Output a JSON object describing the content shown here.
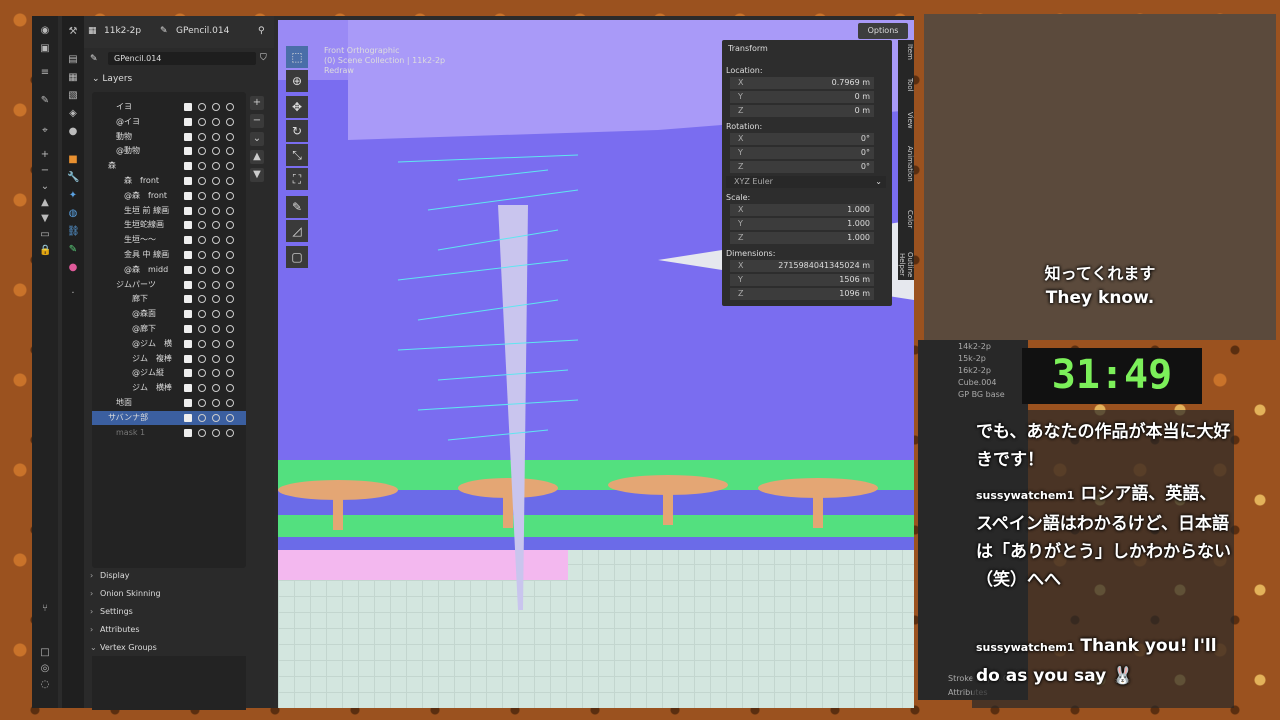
{
  "properties": {
    "header_scene": "11k2-2p",
    "header_object": "GPencil.014",
    "data_name": "GPencil.014"
  },
  "layers_title": "Layers",
  "layers": [
    {
      "name": "イヨ",
      "indent": 1
    },
    {
      "name": "@イヨ",
      "indent": 1
    },
    {
      "name": "動物",
      "indent": 1
    },
    {
      "name": "@動物",
      "indent": 1
    },
    {
      "name": "森",
      "indent": 0,
      "group": true
    },
    {
      "name": "森　front",
      "indent": 2
    },
    {
      "name": "@森　front",
      "indent": 2
    },
    {
      "name": "生垣 前 線画",
      "indent": 2
    },
    {
      "name": "生垣蛇線画",
      "indent": 2
    },
    {
      "name": "生垣〜〜",
      "indent": 2
    },
    {
      "name": "金具 中 線画",
      "indent": 2
    },
    {
      "name": "@森　midd",
      "indent": 2
    },
    {
      "name": "ジムパーツ",
      "indent": 1,
      "group": true
    },
    {
      "name": "廊下",
      "indent": 3
    },
    {
      "name": "@森面",
      "indent": 3
    },
    {
      "name": "@廊下",
      "indent": 3
    },
    {
      "name": "@ジム　横",
      "indent": 3
    },
    {
      "name": "ジム　複棒",
      "indent": 3
    },
    {
      "name": "@ジム縦",
      "indent": 3
    },
    {
      "name": "ジム　横棒",
      "indent": 3
    },
    {
      "name": "地面",
      "indent": 1
    },
    {
      "name": "サバンナ部",
      "indent": 0,
      "group": true,
      "selected": true
    },
    {
      "name": "mask 1",
      "indent": 1,
      "dim": true
    }
  ],
  "sections": [
    "Display",
    "Onion Skinning",
    "Settings",
    "Attributes",
    "Vertex Groups"
  ],
  "viewport": {
    "overlay_line1": "Front Orthographic",
    "overlay_line2": "(0) Scene Collection | 11k2-2p",
    "overlay_line3": "Redraw",
    "options_label": "Options"
  },
  "transform": {
    "title": "Transform",
    "location_label": "Location:",
    "location": {
      "x": "0.7969 m",
      "y": "0 m",
      "z": "0 m"
    },
    "rotation_label": "Rotation:",
    "rotation": {
      "x": "0°",
      "y": "0°",
      "z": "0°"
    },
    "rotation_mode": "XYZ Euler",
    "scale_label": "Scale:",
    "scale": {
      "x": "1.000",
      "y": "1.000",
      "z": "1.000"
    },
    "dimensions_label": "Dimensions:",
    "dimensions": {
      "x": "2715984041345024 m",
      "y": "1506 m",
      "z": "1096 m"
    }
  },
  "ntabs": [
    "Item",
    "Tool",
    "View",
    "Animation",
    "Color",
    "Outline Helper"
  ],
  "outliner_items": [
    "14k2-2p",
    "15k-2p",
    "16k2-2p",
    "Cube.004",
    "GP BG base"
  ],
  "stream": {
    "subtitle_jp": "知ってくれます",
    "subtitle_en": "They know.",
    "timer": "31:49",
    "chat": [
      {
        "user": "",
        "text": "でも、あなたの作品が本当に大好きです！"
      },
      {
        "user": "sussywatchem1",
        "text": "ロシア語、英語、スペイン語はわかるけど、日本語は「ありがとう」しかわからない（笑）へへ"
      },
      {
        "user": "sussywatchem1",
        "text": "Thank you! I'll do as you say 🐰"
      }
    ]
  },
  "outliner_bottom": [
    "Stroke Depth Or...",
    "Attributes"
  ]
}
